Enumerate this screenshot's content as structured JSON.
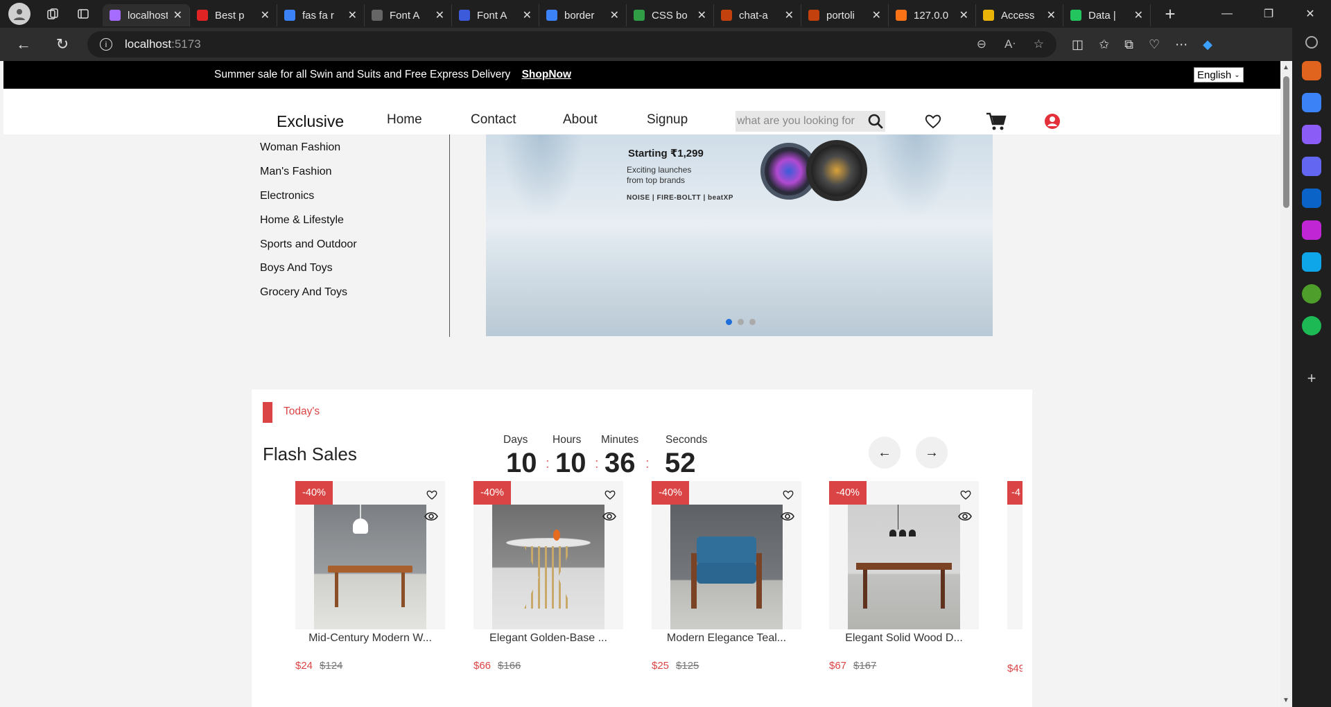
{
  "browser": {
    "tabs": [
      {
        "title": "localhost",
        "color": "#a66bff",
        "active": true
      },
      {
        "title": "Best p",
        "color": "#e02424"
      },
      {
        "title": "fas fa r",
        "color": "#3b82f6"
      },
      {
        "title": "Font A",
        "color": "#666666"
      },
      {
        "title": "Font A",
        "color": "#3b5bdb"
      },
      {
        "title": "border",
        "color": "#3b82f6"
      },
      {
        "title": "CSS bo",
        "color": "#2f9e44"
      },
      {
        "title": "chat-a",
        "color": "#c2410c"
      },
      {
        "title": "portoli",
        "color": "#c2410c"
      },
      {
        "title": "127.0.0",
        "color": "#f97316"
      },
      {
        "title": "Access",
        "color": "#eab308"
      },
      {
        "title": "Data |",
        "color": "#22c55e"
      }
    ],
    "url_host": "localhost",
    "url_port": ":5173"
  },
  "topbar": {
    "message": "Summer sale for all Swin and Suits and Free Express Delivery",
    "shop_link": "ShopNow",
    "language": "English"
  },
  "header": {
    "logo": "Exclusive",
    "nav": [
      "Home",
      "Contact",
      "About",
      "Signup"
    ],
    "search_placeholder": "what are you looking for"
  },
  "categories": [
    "Woman Fashion",
    "Man's Fashion",
    "Electronics",
    "Home & Lifestyle",
    "Sports and Outdoor",
    "Boys And Toys",
    "Grocery And Toys"
  ],
  "banner": {
    "headline": "Starting ₹1,299",
    "sub": "Exciting launches from top brands",
    "brands": "NOISE | FIRE-BOLTT | beatXP",
    "active_slide": 0,
    "slide_count": 3
  },
  "flash": {
    "tag": "Today's",
    "title": "Flash Sales",
    "countdown": {
      "labels": [
        "Days",
        "Hours",
        "Minutes",
        "Seconds"
      ],
      "values": [
        "10",
        "10",
        "36",
        "52"
      ]
    }
  },
  "products": [
    {
      "discount": "-40%",
      "name": "Mid-Century Modern W...",
      "price": "$24",
      "old_price": "$124",
      "color": "#9a5a2e"
    },
    {
      "discount": "-40%",
      "name": "Elegant Golden-Base ...",
      "price": "$66",
      "old_price": "$166",
      "color": "#c8a96a"
    },
    {
      "discount": "-40%",
      "name": "Modern Elegance Teal...",
      "price": "$25",
      "old_price": "$125",
      "color": "#2f6f9a"
    },
    {
      "discount": "-40%",
      "name": "Elegant Solid Wood D...",
      "price": "$67",
      "old_price": "$167",
      "color": "#7a4326"
    },
    {
      "discount": "-4",
      "name": "",
      "price": "$49",
      "old_price": "",
      "color": "#db4444"
    }
  ]
}
